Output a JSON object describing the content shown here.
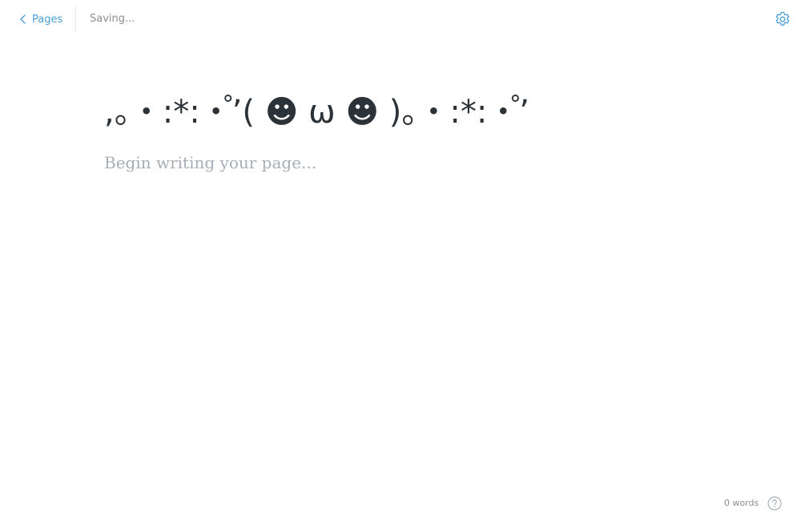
{
  "header": {
    "back_label": "Pages",
    "status": "Saving..."
  },
  "editor": {
    "title": ",。・:*:・゚’( ☻ ω ☻ )。・:*:・゚’",
    "body_placeholder": "Begin writing your page..."
  },
  "footer": {
    "word_count": "0 words"
  },
  "icons": {
    "back": "chevron-left-icon",
    "settings": "gear-icon",
    "help": "question-circle-icon"
  },
  "colors": {
    "accent": "#4a9fd8",
    "text": "#2c3338",
    "muted": "#8a8f94",
    "placeholder": "#a7aeb5"
  }
}
